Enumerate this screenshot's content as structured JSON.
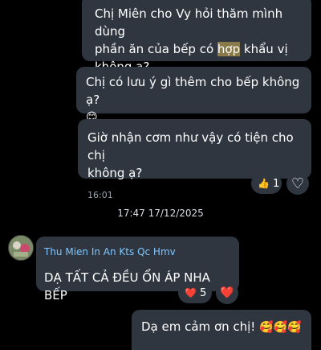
{
  "messages": {
    "m1": {
      "line1": "Chị Miên cho Vy hỏi thăm mình dùng",
      "line2_a": "phần ăn của bếp có ",
      "line2_hl": "hợp",
      "line2_b": " khẩu vị",
      "line3": "không ạ?"
    },
    "m2": {
      "line1": "Chị có lưu ý gì thêm cho bếp không ạ?",
      "emoji": "😊"
    },
    "m3": {
      "line1": "Giờ nhận cơm như vậy có tiện cho chị",
      "line2": "không ạ?",
      "time": "16:01",
      "reaction_emoji": "👍",
      "reaction_count": "1",
      "heart_outline": "♡"
    },
    "date_separator": "17:47 17/12/2025",
    "incoming": {
      "sender": "Thu Mien In An Kts Qc Hmv",
      "text": "DẠ TẤT CẢ ĐỀU ỔN ÁP NHA BẾP",
      "reaction_emoji": "❤️",
      "reaction_count": "5",
      "heart": "❤️"
    },
    "m4": {
      "text": "Dạ em cảm ơn chị!",
      "emojis": "🥰🥰🥰"
    }
  },
  "colors": {
    "background": "#000000",
    "bubble": "#2f3640",
    "sender": "#7fc6ff",
    "highlight": "#8a7a4a"
  }
}
